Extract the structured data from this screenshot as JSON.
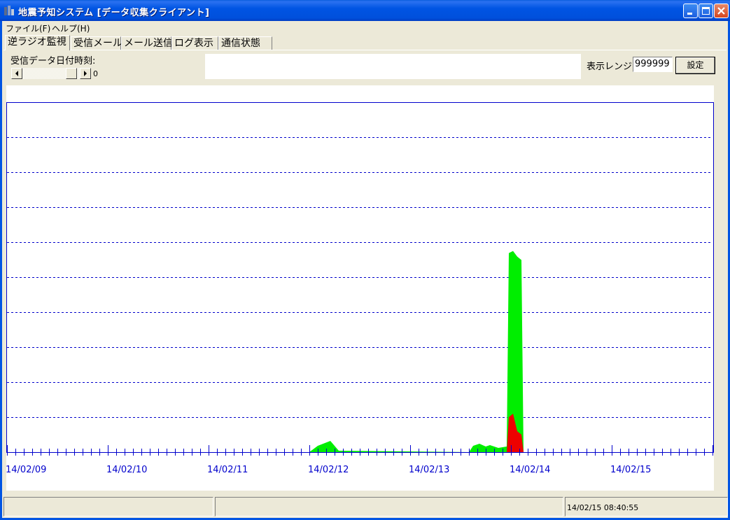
{
  "window": {
    "title": "地震予知システム [データ収集クライアント]"
  },
  "menu": {
    "items": [
      "ファイル(F)",
      "ヘルプ(H)"
    ]
  },
  "tabs": [
    {
      "label": "逆ラジオ監視",
      "active": true
    },
    {
      "label": "受信メール",
      "active": false
    },
    {
      "label": "メール送信",
      "active": false
    },
    {
      "label": "ログ表示",
      "active": false
    },
    {
      "label": "通信状態",
      "active": false
    }
  ],
  "controls": {
    "received_datetime_label": "受信データ日付時刻:",
    "scroll_value": "0",
    "range_label": "表示レンジ:",
    "range_value": "999999",
    "set_button": "設定"
  },
  "colors": {
    "title_bar": "#0054e3",
    "chart_axis": "#0000cc",
    "series_green": "#00ee00",
    "series_red": "#ee0000"
  },
  "chart_data": {
    "type": "area",
    "x_tick_labels": [
      "14/02/09",
      "14/02/10",
      "14/02/11",
      "14/02/12",
      "14/02/13",
      "14/02/14",
      "14/02/15"
    ],
    "xlim": [
      "14/02/09 00:00",
      "14/02/15 24:00"
    ],
    "grid": "horizontal dashed, 9 lines",
    "minor_ticks_per_day": 12,
    "series": [
      {
        "color": "#00ee00",
        "points": [
          [
            "14/02/12 00:00",
            0
          ],
          [
            "14/02/12 02:00",
            0.018
          ],
          [
            "14/02/12 05:00",
            0.032
          ],
          [
            "14/02/12 07:00",
            0.004
          ],
          [
            "14/02/13 14:00",
            0
          ],
          [
            "14/02/13 15:00",
            0.018
          ],
          [
            "14/02/13 16:30",
            0.024
          ],
          [
            "14/02/13 18:00",
            0.016
          ],
          [
            "14/02/13 19:00",
            0.02
          ],
          [
            "14/02/13 21:00",
            0.012
          ],
          [
            "14/02/13 23:00",
            0.016
          ],
          [
            "14/02/13 23:30",
            0.57
          ],
          [
            "14/02/14 00:30",
            0.576
          ],
          [
            "14/02/14 01:30",
            0.56
          ],
          [
            "14/02/14 02:30",
            0.55
          ],
          [
            "14/02/14 03:00",
            0
          ]
        ]
      },
      {
        "color": "#ee0000",
        "points": [
          [
            "14/02/13 23:00",
            0
          ],
          [
            "14/02/13 23:30",
            0.1
          ],
          [
            "14/02/14 00:30",
            0.11
          ],
          [
            "14/02/14 01:30",
            0.06
          ],
          [
            "14/02/14 02:30",
            0.05
          ],
          [
            "14/02/14 03:00",
            0
          ]
        ]
      }
    ]
  },
  "status": {
    "panel_1": "",
    "panel_2": "",
    "timestamp": "14/02/15 08:40:55"
  }
}
